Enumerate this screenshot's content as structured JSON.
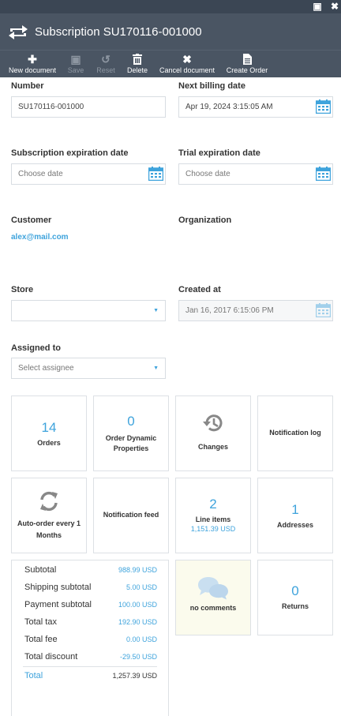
{
  "window": {
    "title": "Subscription SU170116-001000"
  },
  "toolbar": {
    "new_document": "New document",
    "save": "Save",
    "reset": "Reset",
    "delete": "Delete",
    "cancel_document": "Cancel document",
    "create_order": "Create Order"
  },
  "form": {
    "number": {
      "label": "Number",
      "value": "SU170116-001000"
    },
    "next_billing": {
      "label": "Next billing date",
      "value": "Apr 19, 2024 3:15:05 AM"
    },
    "subscription_expiration": {
      "label": "Subscription expiration date",
      "placeholder": "Choose date"
    },
    "trial_expiration": {
      "label": "Trial expiration date",
      "placeholder": "Choose date"
    },
    "customer": {
      "label": "Customer",
      "value": "alex@mail.com"
    },
    "organization": {
      "label": "Organization"
    },
    "store": {
      "label": "Store",
      "value": ""
    },
    "created_at": {
      "label": "Created at",
      "value": "Jan 16, 2017 6:15:06 PM"
    },
    "assigned_to": {
      "label": "Assigned to",
      "placeholder": "Select assignee"
    }
  },
  "tiles": {
    "orders": {
      "count": "14",
      "label": "Orders"
    },
    "dynamic": {
      "count": "0",
      "label_line1": "Order Dynamic",
      "label_line2": "Properties"
    },
    "changes": {
      "label": "Changes"
    },
    "notif_log": {
      "label": "Notification log"
    },
    "auto_order": {
      "label_line1": "Auto-order every 1",
      "label_line2": "Months"
    },
    "notif_feed": {
      "label": "Notification feed"
    },
    "line_items": {
      "count": "2",
      "label": "Line items",
      "sub": "1,151.39 USD"
    },
    "addresses": {
      "count": "1",
      "label": "Addresses"
    },
    "comments": {
      "label": "no comments"
    },
    "returns": {
      "count": "0",
      "label": "Returns"
    }
  },
  "totals": [
    {
      "label": "Subtotal",
      "value": "988.99 USD"
    },
    {
      "label": "Shipping subtotal",
      "value": "5.00 USD"
    },
    {
      "label": "Payment subtotal",
      "value": "100.00 USD"
    },
    {
      "label": "Total tax",
      "value": "192.90 USD"
    },
    {
      "label": "Total fee",
      "value": "0.00 USD"
    },
    {
      "label": "Total discount",
      "value": "-29.50 USD"
    },
    {
      "label": "Total",
      "value": "1,257.39 USD"
    }
  ],
  "colors": {
    "header": "#4a5563",
    "accent": "#3ea3dc",
    "tile_border": "#dde1e5",
    "comments_bg": "#fbfbed"
  }
}
